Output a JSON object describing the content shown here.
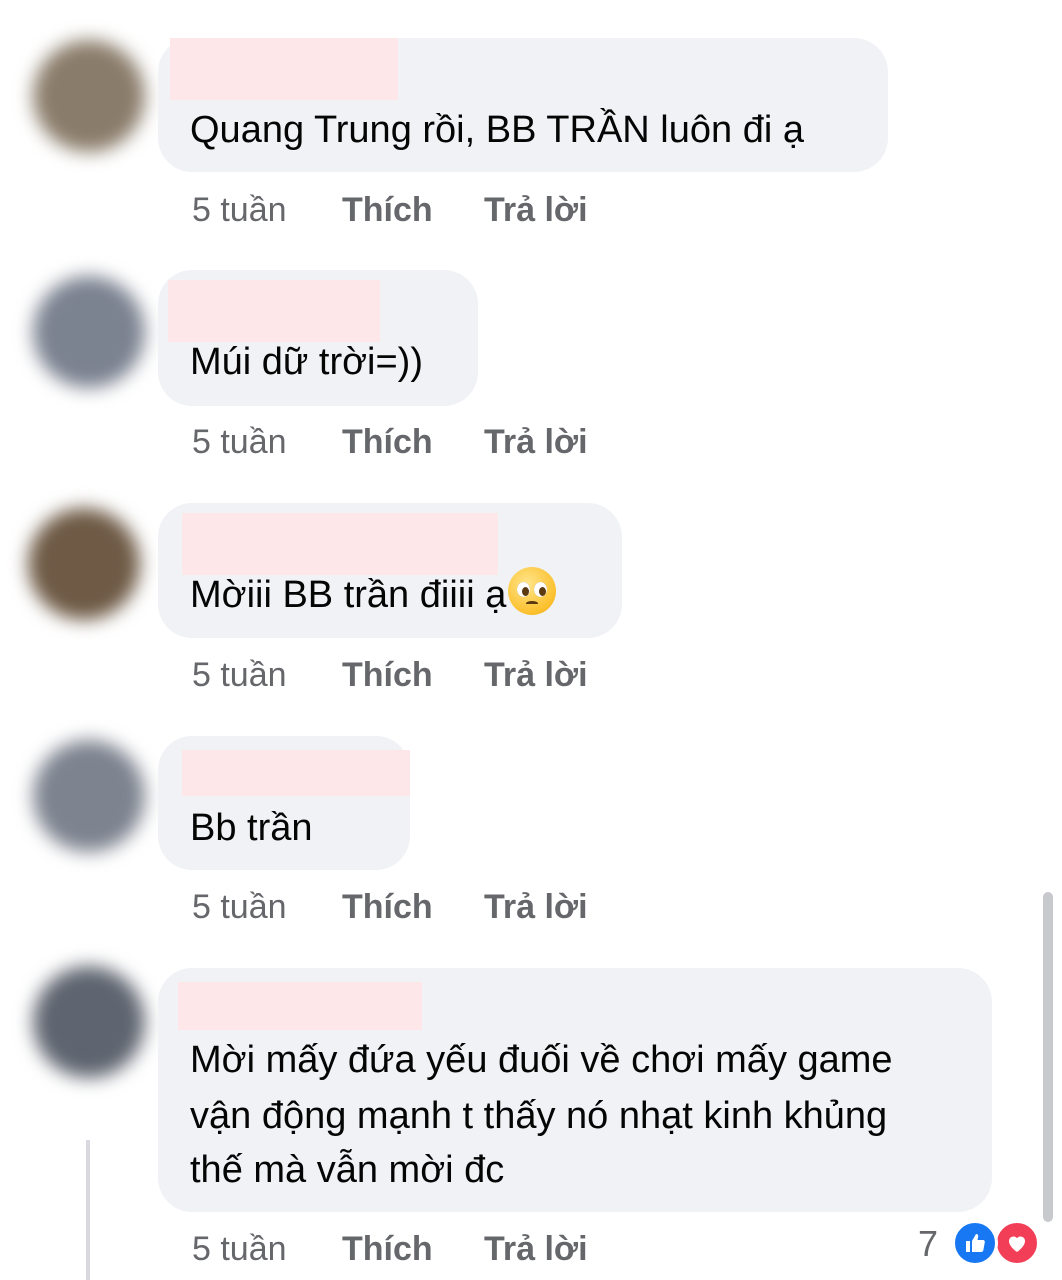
{
  "comments": [
    {
      "text_lines": [
        "Quang Trung rồi, BB TRẦN luôn đi ạ"
      ],
      "time": "5 tuần",
      "like_label": "Thích",
      "reply_label": "Trả lời",
      "avatar_color": "#8a7c6a"
    },
    {
      "text_lines": [
        "Múi dữ trời=))"
      ],
      "time": "5 tuần",
      "like_label": "Thích",
      "reply_label": "Trả lời",
      "avatar_color": "#7b8290"
    },
    {
      "text_lines": [
        "Mờiii BB trần điiii ạ"
      ],
      "emoji": "pleading-face-emoji",
      "time": "5 tuần",
      "like_label": "Thích",
      "reply_label": "Trả lời",
      "avatar_color": "#6e5a45"
    },
    {
      "text_lines": [
        "Bb trần"
      ],
      "time": "5 tuần",
      "like_label": "Thích",
      "reply_label": "Trả lời",
      "avatar_color": "#7d838f"
    },
    {
      "text_lines": [
        "Mời mấy đứa yếu đuối về chơi mấy game",
        "vận động mạnh t thấy nó nhạt kinh khủng",
        "thế mà vẫn mời đc"
      ],
      "time": "5 tuần",
      "like_label": "Thích",
      "reply_label": "Trả lời",
      "avatar_color": "#5f6570",
      "reactions": {
        "count": "7",
        "types": [
          "like-icon",
          "love-icon"
        ]
      }
    }
  ],
  "colors": {
    "bubble": "#f0f2f5",
    "meta_text": "#65676b",
    "name_redaction": "#fde7e9",
    "like_blue": "#1877f2",
    "love_red": "#f33e58"
  }
}
